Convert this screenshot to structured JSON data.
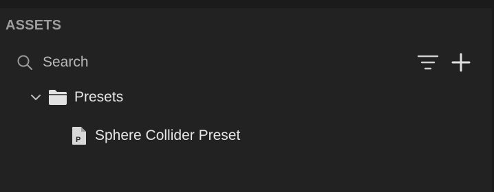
{
  "panel": {
    "title": "ASSETS"
  },
  "search": {
    "placeholder": "Search",
    "value": ""
  },
  "toolbar": {
    "filter_icon": "filter-lines-icon",
    "add_icon": "plus-icon"
  },
  "tree": {
    "folders": [
      {
        "label": "Presets",
        "expanded": true,
        "icon": "folder-icon",
        "children": [
          {
            "label": "Sphere Collider Preset",
            "icon": "preset-file-icon",
            "badge": "P"
          }
        ]
      }
    ]
  },
  "colors": {
    "background": "#222222",
    "title": "#9e9e9e",
    "text": "#e6e6e6",
    "icon": "#d0d0d0"
  }
}
